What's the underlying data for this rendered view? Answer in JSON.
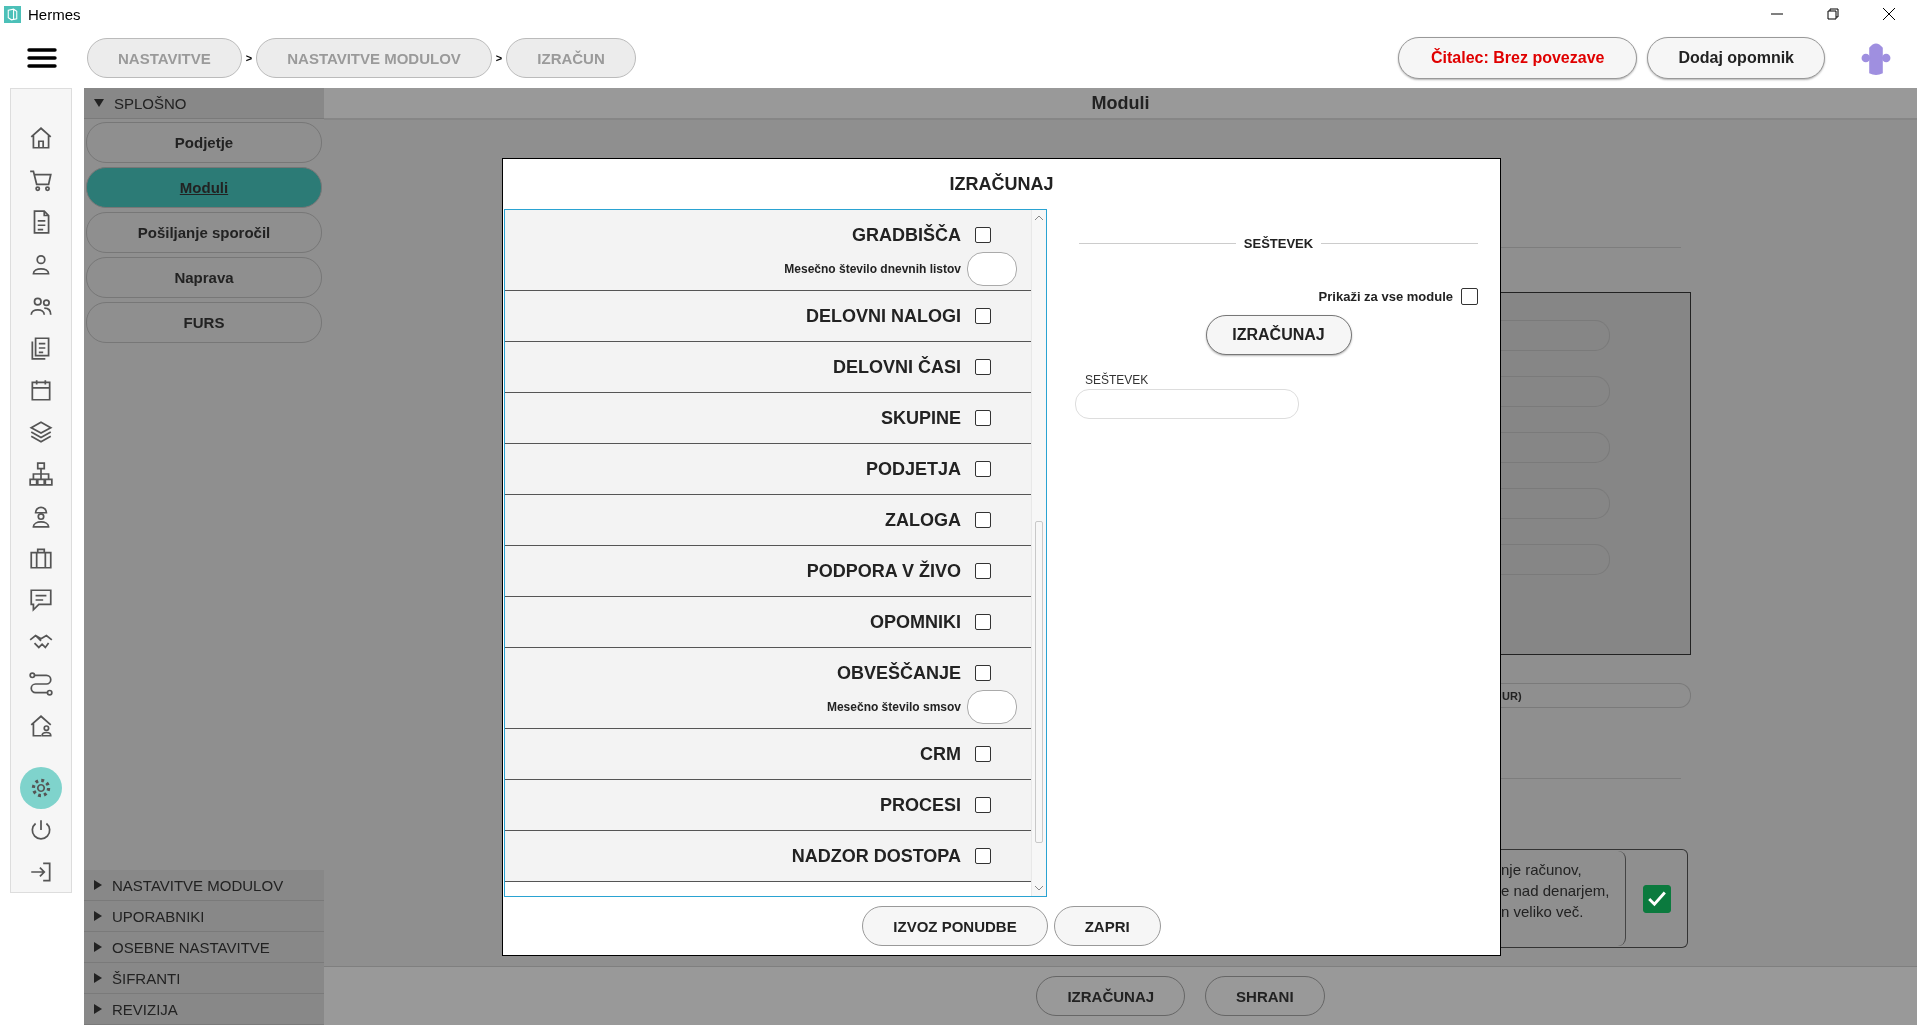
{
  "window": {
    "title": "Hermes"
  },
  "breadcrumbs": [
    {
      "label": "NASTAVITVE"
    },
    {
      "label": "NASTAVITVE MODULOV"
    },
    {
      "label": "IZRAČUN"
    }
  ],
  "breadcrumb_separators": [
    ">",
    ">"
  ],
  "header_buttons": [
    {
      "label": "Čitalec: Brez povezave",
      "kind": "alert"
    },
    {
      "label": "Dodaj opomnik",
      "kind": "normal"
    }
  ],
  "nav_icons": [
    {
      "selected": false
    },
    {
      "selected": false
    },
    {
      "selected": false
    },
    {
      "selected": false
    },
    {
      "selected": false
    },
    {
      "selected": false
    },
    {
      "selected": false
    },
    {
      "selected": false
    },
    {
      "selected": false
    },
    {
      "selected": false
    },
    {
      "selected": false
    },
    {
      "selected": false
    },
    {
      "selected": false
    },
    {
      "selected": false
    },
    {
      "selected": false
    },
    {
      "selected": true
    },
    {
      "selected": false
    },
    {
      "selected": false
    }
  ],
  "nav_sections": [
    {
      "label": "SPLOŠNO",
      "expanded": true,
      "items": [
        {
          "label": "Podjetje",
          "selected": false
        },
        {
          "label": "Moduli",
          "selected": true
        },
        {
          "label": "Pošiljanje sporočil",
          "selected": false
        },
        {
          "label": "Naprava",
          "selected": false
        },
        {
          "label": "FURS",
          "selected": false
        }
      ]
    },
    {
      "label": "NASTAVITVE MODULOV",
      "expanded": false
    },
    {
      "label": "UPORABNIKI",
      "expanded": false
    },
    {
      "label": "OSEBNE NASTAVITVE",
      "expanded": false
    },
    {
      "label": "ŠIFRANTI",
      "expanded": false
    },
    {
      "label": "REVIZIJA",
      "expanded": false
    }
  ],
  "page": {
    "title": "Moduli",
    "partial_label": "UR)",
    "partial_text": [
      "nje računov,",
      "e nad denarjem,",
      "n veliko več."
    ],
    "partial_checked": true,
    "buttons": [
      "IZRAČUNAJ",
      "SHRANI"
    ]
  },
  "modal": {
    "title": "IZRAČUNAJ",
    "modules": [
      {
        "label": "GRADBIŠČA",
        "checked": false,
        "field_label": "Mesečno število dnevnih listov"
      },
      {
        "label": "DELOVNI NALOGI",
        "checked": false
      },
      {
        "label": "DELOVNI ČASI",
        "checked": false
      },
      {
        "label": "SKUPINE",
        "checked": false
      },
      {
        "label": "PODJETJA",
        "checked": false
      },
      {
        "label": "ZALOGA",
        "checked": false
      },
      {
        "label": "PODPORA V ŽIVO",
        "checked": false
      },
      {
        "label": "OPOMNIKI",
        "checked": false
      },
      {
        "label": "OBVEŠČANJE",
        "checked": false,
        "field_label": "Mesečno število smsov"
      },
      {
        "label": "CRM",
        "checked": false
      },
      {
        "label": "PROCESI",
        "checked": false
      },
      {
        "label": "NADZOR DOSTOPA",
        "checked": false
      }
    ],
    "summary": {
      "heading": "SEŠTEVEK",
      "show_all_label": "Prikaži za vse module",
      "show_all_checked": false,
      "button": "IZRAČUNAJ",
      "field_label": "SEŠTEVEK"
    },
    "buttons": [
      "IZVOZ PONUDBE",
      "ZAPRI"
    ]
  }
}
